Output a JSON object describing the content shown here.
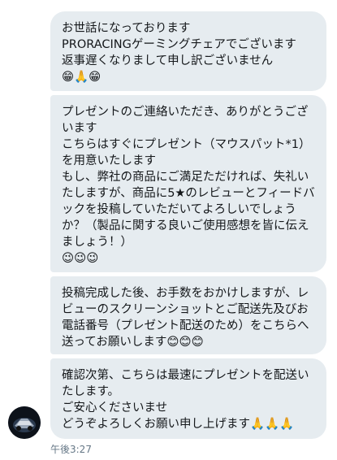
{
  "messages": [
    {
      "text": "お世話になっております\nPRORACINGゲーミングチェアでございます\n返事遅くなりまして申し訳ございません\n😁🙏😁"
    },
    {
      "text": "プレゼントのご連絡いただき、ありがとうございます\nこちらはすぐにプレゼント（マウスパット*1）を用意いたします\nもし、弊社の商品にご満足ただければ、失礼いたしますが、商品に5★のレビューとフィードバックを投稿していただいてよろしいでしょうか？（製品に関する良いご使用感想を皆に伝えましょう！）\n😉😉😉"
    },
    {
      "text": "投稿完成した後、お手数をおかけしますが、レビューのスクリーンショットとご配送先及びお電話番号（プレゼント配送のため）をこちらへ送ってお願いします😊😊😊"
    },
    {
      "text": "確認次第、こちらは最速にプレゼントを配送いたします。\nご安心くださいませ\nどうぞよろしくお願い申し上げます🙏🙏🙏"
    }
  ],
  "sender": {
    "avatar_icon": "sender-avatar-icon"
  },
  "timestamp": "午後3:27"
}
